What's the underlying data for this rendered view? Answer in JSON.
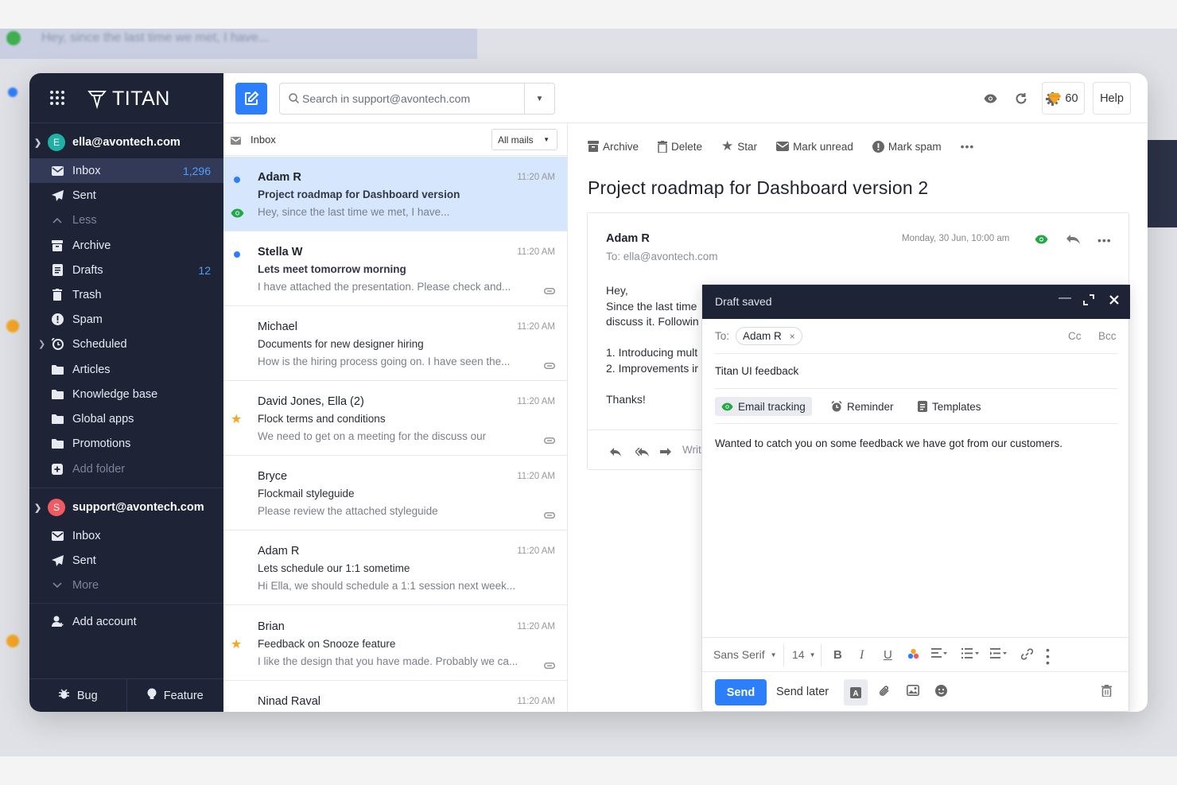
{
  "background": {
    "blurred_snippet": "Hey, since the last time we met, I have..."
  },
  "brand": {
    "name": "TITAN"
  },
  "accounts": [
    {
      "email": "ella@avontech.com",
      "initial": "E",
      "color": "#1fb0a8",
      "folders": [
        {
          "label": "Inbox",
          "count": "1,296",
          "icon": "envelope-icon"
        },
        {
          "label": "Sent",
          "count": "",
          "icon": "paper-plane-icon"
        },
        {
          "label": "Less",
          "count": "",
          "icon": "chevron-up-icon"
        },
        {
          "label": "Archive",
          "count": "",
          "icon": "archive-icon"
        },
        {
          "label": "Drafts",
          "count": "12",
          "icon": "draft-icon"
        },
        {
          "label": "Trash",
          "count": "",
          "icon": "trash-icon"
        },
        {
          "label": "Spam",
          "count": "",
          "icon": "spam-icon"
        },
        {
          "label": "Scheduled",
          "count": "",
          "icon": "scheduled-icon"
        },
        {
          "label": "Articles",
          "count": "",
          "icon": "folder-icon"
        },
        {
          "label": "Knowledge base",
          "count": "",
          "icon": "folder-icon"
        },
        {
          "label": "Global apps",
          "count": "",
          "icon": "folder-icon"
        },
        {
          "label": "Promotions",
          "count": "",
          "icon": "folder-icon"
        },
        {
          "label": "Add folder",
          "count": "",
          "icon": "plus-icon"
        }
      ]
    },
    {
      "email": "support@avontech.com",
      "initial": "S",
      "color": "#f05a63",
      "folders": [
        {
          "label": "Inbox",
          "count": "",
          "icon": "envelope-icon"
        },
        {
          "label": "Sent",
          "count": "",
          "icon": "paper-plane-icon"
        },
        {
          "label": "More",
          "count": "",
          "icon": "chevron-down-icon"
        }
      ]
    }
  ],
  "add_account": "Add account",
  "footer": {
    "bug": "Bug",
    "feature": "Feature"
  },
  "search": {
    "placeholder": "Search in support@avontech.com"
  },
  "coins": "60",
  "help": "Help",
  "list": {
    "folder": "Inbox",
    "filter": "All mails",
    "mails": [
      {
        "from": "Adam R",
        "subject": "Project roadmap for Dashboard version",
        "preview": "Hey, since the last time we met, I have...",
        "time": "11:20 AM"
      },
      {
        "from": "Stella W",
        "subject": "Lets meet tomorrow morning",
        "preview": "I have attached the presentation. Please check and...",
        "time": "11:20 AM"
      },
      {
        "from": "Michael",
        "subject": "Documents for new designer hiring",
        "preview": "How is the hiring process going on. I have seen the...",
        "time": "11:20 AM"
      },
      {
        "from": "David Jones, Ella (2)",
        "subject": "Flock terms and conditions",
        "preview": "We need to get on a meeting for the discuss our",
        "time": "11:20 AM"
      },
      {
        "from": "Bryce",
        "subject": "Flockmail styleguide",
        "preview": "Please review the attached styleguide",
        "time": "11:20 AM"
      },
      {
        "from": "Adam R",
        "subject": "Lets schedule our 1:1 sometime",
        "preview": "Hi Ella, we should schedule a 1:1 session next week...",
        "time": "11:20 AM"
      },
      {
        "from": "Brian",
        "subject": "Feedback on Snooze feature",
        "preview": "I like the design that you have made. Probably we ca...",
        "time": "11:20 AM"
      },
      {
        "from": "Ninad Raval",
        "subject": "",
        "preview": "",
        "time": "11:20 AM"
      }
    ]
  },
  "reader": {
    "actions": [
      "Archive",
      "Delete",
      "Star",
      "Mark unread",
      "Mark spam"
    ],
    "title": "Project roadmap for Dashboard version 2",
    "sender": "Adam R",
    "to": "To: ella@avontech.com",
    "date": "Monday, 30 Jun, 10:00 am",
    "body": [
      "Hey,",
      "Since the last time",
      "discuss it. Followin",
      "",
      "1. Introducing mult",
      "2. Improvements ir",
      "",
      "Thanks!"
    ],
    "reply_placeholder": "Writ"
  },
  "compose": {
    "status": "Draft saved",
    "to_label": "To:",
    "recipient": "Adam R",
    "cc": "Cc",
    "bcc": "Bcc",
    "subject": "Titan UI feedback",
    "options": [
      "Email tracking",
      "Reminder",
      "Templates"
    ],
    "body": "Wanted to catch you on some feedback we have got from our customers.",
    "font": "Sans Serif",
    "size": "14",
    "send": "Send",
    "send_later": "Send later"
  }
}
